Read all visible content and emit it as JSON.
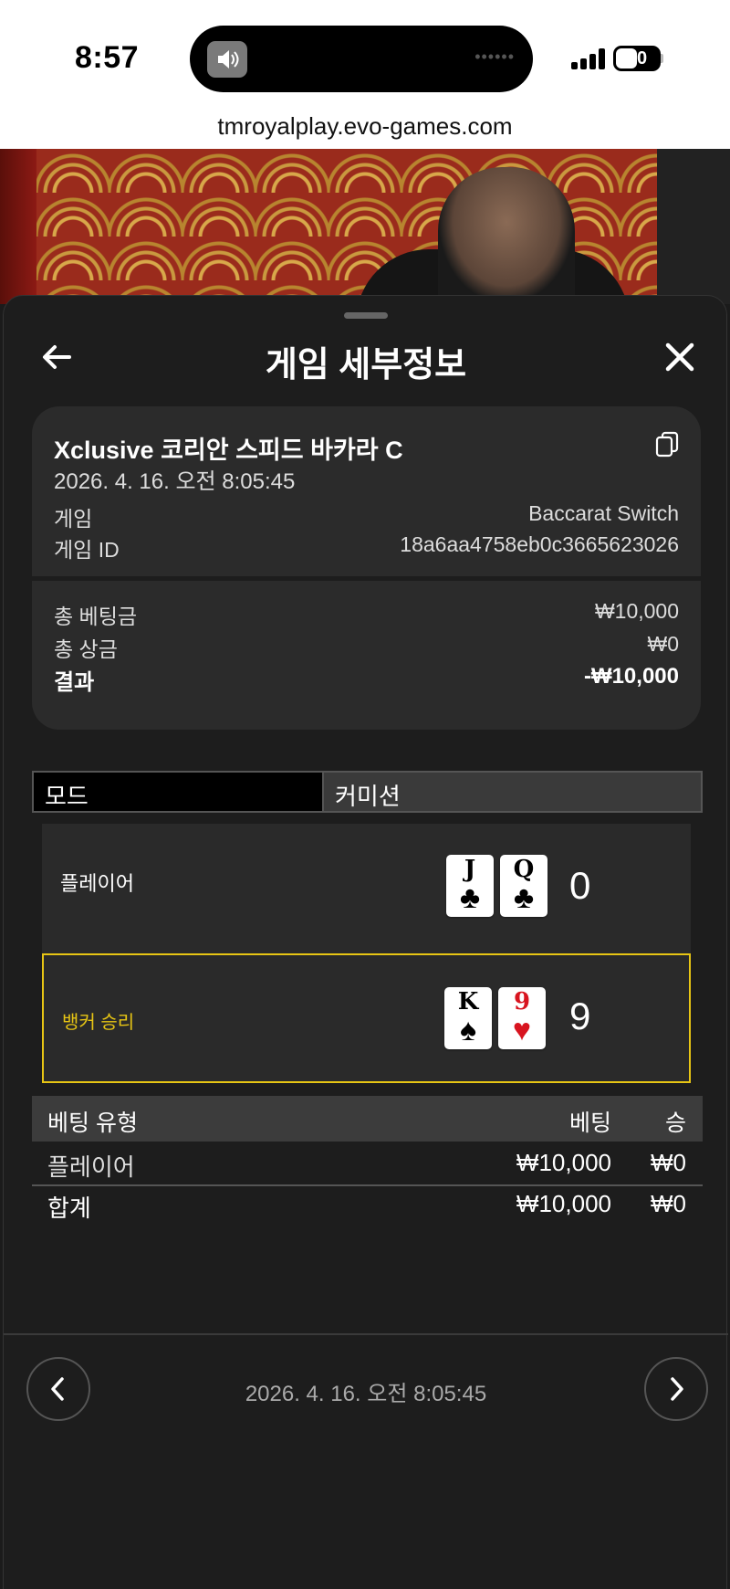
{
  "status_bar": {
    "time": "8:57",
    "battery": "40"
  },
  "browser": {
    "url": "tmroyalplay.evo-games.com"
  },
  "sheet": {
    "title": "게임 세부정보"
  },
  "game_info": {
    "name": "Xclusive 코리안 스피드 바카라 C",
    "datetime": "2026. 4. 16. 오전 8:05:45",
    "game_label": "게임",
    "game_value": "Baccarat Switch",
    "game_id_label": "게임 ID",
    "game_id_value": "18a6aa4758eb0c3665623026"
  },
  "totals": {
    "total_bet_label": "총 베팅금",
    "total_bet_value": "₩10,000",
    "total_win_label": "총 상금",
    "total_win_value": "₩0",
    "result_label": "결과",
    "result_value": "-₩10,000"
  },
  "mode_bar": {
    "left": "모드",
    "right": "커미션"
  },
  "hands": {
    "player": {
      "label": "플레이어",
      "cards": [
        {
          "rank": "J",
          "suit": "♣"
        },
        {
          "rank": "Q",
          "suit": "♣"
        }
      ],
      "score": "0"
    },
    "banker": {
      "label": "뱅커 승리",
      "cards": [
        {
          "rank": "K",
          "suit": "♠"
        },
        {
          "rank": "9",
          "suit": "♥"
        }
      ],
      "score": "9"
    }
  },
  "bets_table": {
    "headers": {
      "type": "베팅 유형",
      "bet": "베팅",
      "win": "승"
    },
    "rows": [
      {
        "type": "플레이어",
        "bet": "₩10,000",
        "win": "₩0"
      }
    ],
    "total": {
      "type": "합계",
      "bet": "₩10,000",
      "win": "₩0"
    }
  },
  "footer": {
    "datetime": "2026. 4. 16. 오전 8:05:45"
  },
  "colors": {
    "accent_winner": "#e7c514",
    "sheet_bg": "#1d1d1d",
    "card_bg": "#2b2b2b"
  },
  "icons": [
    "back-arrow-icon",
    "close-icon",
    "copy-icon",
    "chevron-left-icon",
    "chevron-right-icon",
    "volume-icon",
    "signal-icon",
    "battery-icon"
  ]
}
